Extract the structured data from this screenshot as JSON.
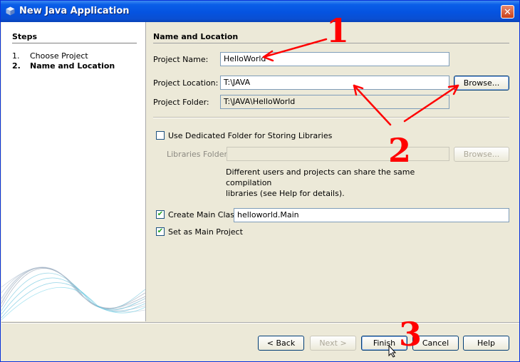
{
  "window": {
    "title": "New Java Application",
    "close_label": "✕"
  },
  "steps": {
    "heading": "Steps",
    "items": [
      {
        "num": "1.",
        "label": "Choose Project"
      },
      {
        "num": "2.",
        "label": "Name and Location"
      }
    ]
  },
  "form": {
    "section_title": "Name and Location",
    "project_name_label": "Project Name:",
    "project_name_value": "HelloWorld",
    "project_location_label": "Project Location:",
    "project_location_value": "T:\\JAVA",
    "browse_label": "Browse...",
    "project_folder_label": "Project Folder:",
    "project_folder_value": "T:\\JAVA\\HelloWorld",
    "dedicated_folder_label": "Use Dedicated Folder for Storing Libraries",
    "dedicated_folder_checked": false,
    "libraries_folder_label": "Libraries Folder:",
    "libraries_folder_value": "",
    "libraries_browse_label": "Browse...",
    "note_line1": "Different users and projects can share the same compilation",
    "note_line2": "libraries (see Help for details).",
    "create_main_class_label": "Create Main Class",
    "create_main_class_checked": true,
    "main_class_value": "helloworld.Main",
    "set_main_project_label": "Set as Main Project",
    "set_main_project_checked": true
  },
  "buttons": {
    "back": "< Back",
    "next": "Next >",
    "finish": "Finish",
    "cancel": "Cancel",
    "help": "Help"
  },
  "annotations": {
    "one": "1",
    "two": "2",
    "three": "3",
    "color": "#ff0000"
  }
}
